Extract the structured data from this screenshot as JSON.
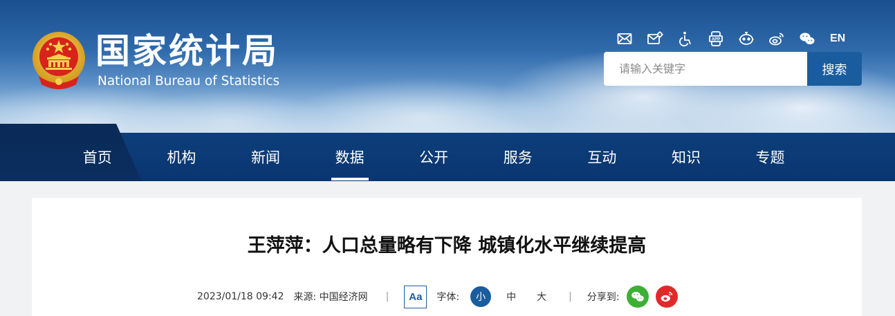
{
  "site": {
    "title": "国家统计局",
    "subtitle": "National Bureau of Statistics"
  },
  "toolbar": {
    "icons": [
      "mail-icon",
      "mail-settings-icon",
      "accessibility-icon",
      "app-icon",
      "robot-icon",
      "weibo-icon",
      "wechat-icon"
    ],
    "en_label": "EN"
  },
  "search": {
    "placeholder": "请输入关键字",
    "button_label": "搜索"
  },
  "nav": {
    "items": [
      {
        "label": "首页",
        "active": false
      },
      {
        "label": "机构",
        "active": false
      },
      {
        "label": "新闻",
        "active": false
      },
      {
        "label": "数据",
        "active": true
      },
      {
        "label": "公开",
        "active": false
      },
      {
        "label": "服务",
        "active": false
      },
      {
        "label": "互动",
        "active": false
      },
      {
        "label": "知识",
        "active": false
      },
      {
        "label": "专题",
        "active": false
      }
    ]
  },
  "article": {
    "title": "王萍萍：人口总量略有下降 城镇化水平继续提高",
    "date": "2023/01/18 09:42",
    "source": "来源: 中国经济网",
    "separator": "|",
    "font_icon_label": "Aa",
    "font_label": "字体:",
    "font_sizes": [
      {
        "label": "小",
        "active": true
      },
      {
        "label": "中",
        "active": false
      },
      {
        "label": "大",
        "active": false
      }
    ],
    "share_label": "分享到:"
  },
  "colors": {
    "brand_blue": "#1a5d9e",
    "nav_bg": "#0d3f7a",
    "wechat_green": "#3cb034",
    "weibo_red": "#e02a2a"
  }
}
